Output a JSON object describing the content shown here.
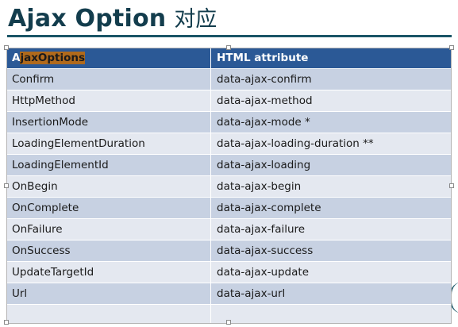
{
  "slide": {
    "title_main": "Ajax Option",
    "title_sub": "对应"
  },
  "table": {
    "headers": {
      "col1_first_letter": "A",
      "col1_rest": "jaxOptions",
      "col2": "HTML attribute"
    },
    "rows": [
      {
        "option": "Confirm",
        "attribute": "data-ajax-confirm"
      },
      {
        "option": "HttpMethod",
        "attribute": "data-ajax-method"
      },
      {
        "option": "InsertionMode",
        "attribute": "data-ajax-mode *"
      },
      {
        "option": "LoadingElementDuration",
        "attribute": "data-ajax-loading-duration **"
      },
      {
        "option": "LoadingElementId",
        "attribute": "data-ajax-loading"
      },
      {
        "option": "OnBegin",
        "attribute": "data-ajax-begin"
      },
      {
        "option": "OnComplete",
        "attribute": "data-ajax-complete"
      },
      {
        "option": "OnFailure",
        "attribute": "data-ajax-failure"
      },
      {
        "option": "OnSuccess",
        "attribute": "data-ajax-success"
      },
      {
        "option": "UpdateTargetId",
        "attribute": "data-ajax-update"
      },
      {
        "option": "Url",
        "attribute": "data-ajax-url"
      },
      {
        "option": "",
        "attribute": ""
      }
    ]
  },
  "colors": {
    "title": "#133d4d",
    "header_bg": "#2b5996",
    "row_dark": "#c7d1e2",
    "row_light": "#e4e8f0",
    "highlight": "#b06a1c"
  }
}
